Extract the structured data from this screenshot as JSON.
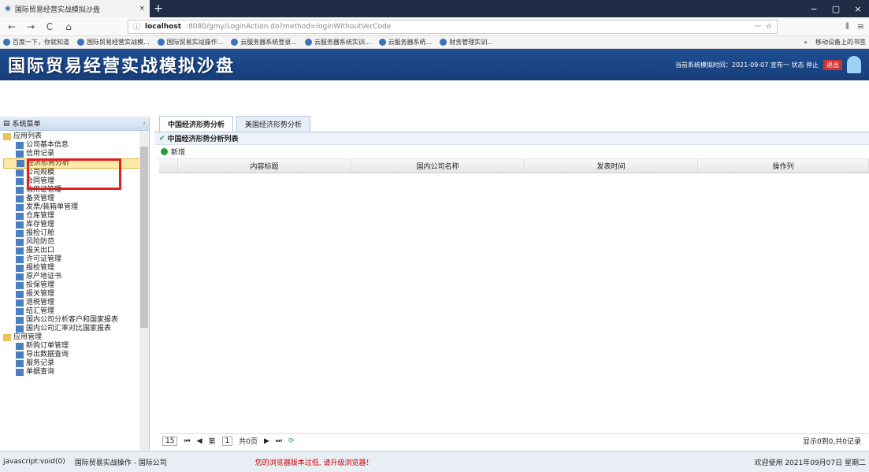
{
  "browser": {
    "tab_title": "国际贸易经营实战模拟沙盘",
    "tab_close": "×",
    "newtab": "+",
    "min": "−",
    "max": "▢",
    "close": "×"
  },
  "nav": {
    "back": "←",
    "forward": "→",
    "reload": "C",
    "home": "⌂",
    "url_host": "localhost",
    "url_path": ":8080/gmy/LoginAction.do?method=loginWithoutVerCode",
    "more": "···",
    "star": "☆",
    "lib": "⫴",
    "menu": "≡"
  },
  "bookmarks": [
    "百度一下，你就知道",
    "国际贸易经营实战模...",
    "国际贸易实战操作...",
    "云服务器系统登录...",
    "云服务器系统实训...",
    "云服务器系统...",
    "财务管理实训..."
  ],
  "bookmarks_more": "»",
  "bookmarks_right": "移动设备上的书签",
  "header": {
    "logo": "国际贸易经营实战模拟沙盘",
    "info": "当前系统模拟时间：2021-09-07 宣布一 状态 停止",
    "exit": "退出"
  },
  "sidebar": {
    "title": "系统菜单",
    "items": [
      {
        "label": "应用列表",
        "level": 0
      },
      {
        "label": "公司基本信息",
        "level": 1
      },
      {
        "label": "信用记录",
        "level": 1
      },
      {
        "label": "经济形势分析",
        "level": 1,
        "selected": true
      },
      {
        "label": "公司规模",
        "level": 1
      },
      {
        "label": "合同管理",
        "level": 1
      },
      {
        "label": "信用证管理",
        "level": 1
      },
      {
        "label": "备货管理",
        "level": 1
      },
      {
        "label": "发票/装箱单管理",
        "level": 1
      },
      {
        "label": "仓库管理",
        "level": 1
      },
      {
        "label": "库存管理",
        "level": 1
      },
      {
        "label": "报检订舱",
        "level": 1
      },
      {
        "label": "风险防范",
        "level": 1
      },
      {
        "label": "报关出口",
        "level": 1
      },
      {
        "label": "许可证管理",
        "level": 1
      },
      {
        "label": "报检管理",
        "level": 1
      },
      {
        "label": "原产地证书",
        "level": 1
      },
      {
        "label": "投保管理",
        "level": 1
      },
      {
        "label": "报关管理",
        "level": 1
      },
      {
        "label": "退税管理",
        "level": 1
      },
      {
        "label": "结汇管理",
        "level": 1
      },
      {
        "label": "国内公司分析客户和国家报表",
        "level": 1
      },
      {
        "label": "国内公司汇率对比国家报表",
        "level": 1
      },
      {
        "label": "应用管理",
        "level": 0
      },
      {
        "label": "新购订单管理",
        "level": 1
      },
      {
        "label": "导出数据查询",
        "level": 1
      },
      {
        "label": "服务记录",
        "level": 1
      },
      {
        "label": "单据查询",
        "level": 1
      }
    ]
  },
  "main": {
    "tabs": [
      {
        "label": "中国经济形势分析",
        "active": true
      },
      {
        "label": "美国经济形势分析",
        "active": false
      }
    ],
    "panel_title": "中国经济形势分析列表",
    "add_label": "新增",
    "columns": [
      {
        "label": "内容标题"
      },
      {
        "label": "国内公司名称"
      },
      {
        "label": "发表时间"
      },
      {
        "label": "操作列"
      }
    ],
    "pager": {
      "size": "15",
      "first": "⏮",
      "prev": "◀",
      "page_label": "第",
      "page": "1",
      "total": "共0页",
      "next": "▶",
      "last": "⏭",
      "refresh": "⟳",
      "info": "显示0到0,共0记录"
    }
  },
  "status": {
    "left": "javascript:void(0)",
    "app": "国际贸易实战操作 - 国际公司",
    "red": "您的浏览器版本过低, 请升级浏览器！",
    "right": "欢迎使用 2021年09月07日 星期二"
  }
}
